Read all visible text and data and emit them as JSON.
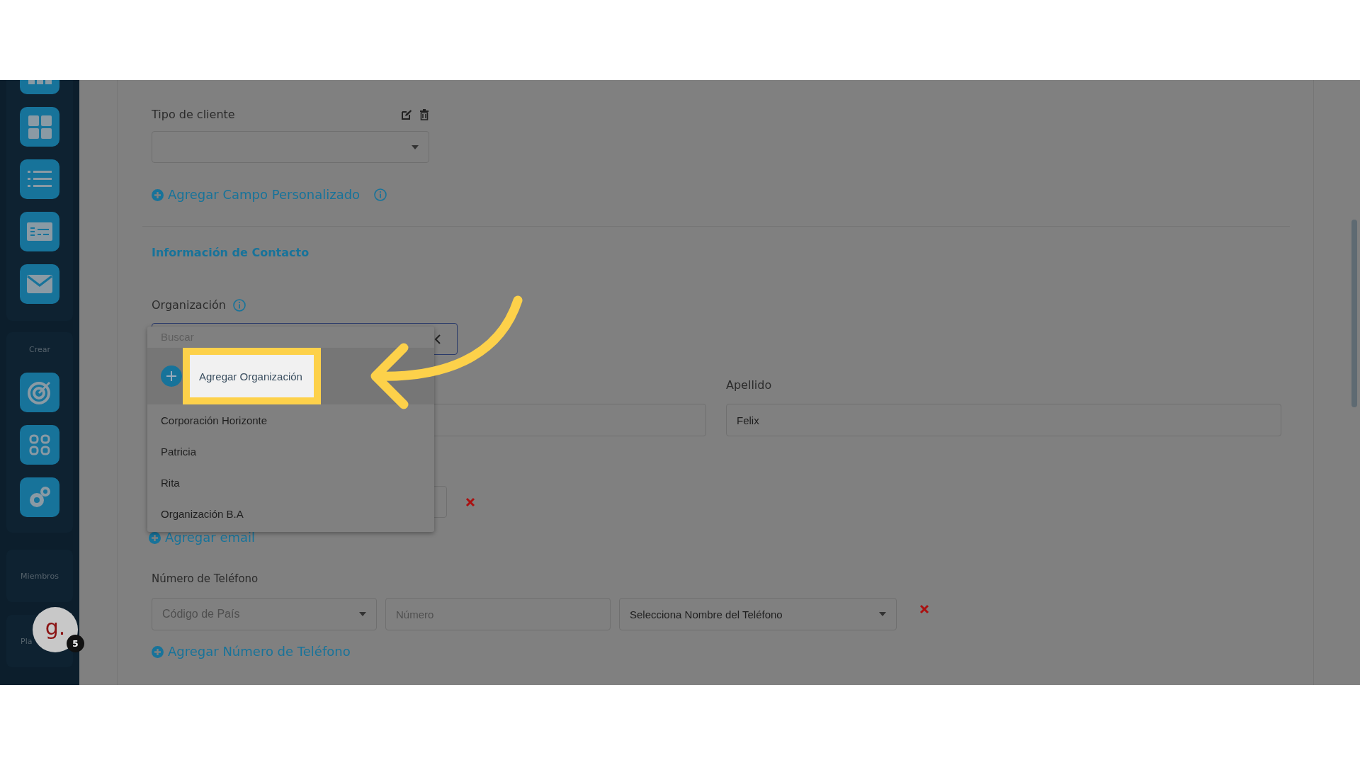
{
  "sidebar": {
    "create_label": "Crear",
    "members_label": "Miembros",
    "plan_label": "Pla",
    "avatar": {
      "initial": "g.",
      "badge": "5"
    }
  },
  "client_type": {
    "label": "Tipo de cliente"
  },
  "add_custom_field": "Agregar Campo Personalizado",
  "contact_section": {
    "title": "Información de Contacto"
  },
  "organization": {
    "label": "Organización",
    "search_placeholder": "Buscar",
    "options": [
      {
        "kind": "add",
        "label": "Agregar Organización",
        "selected": true
      },
      {
        "kind": "option",
        "label": "Corporación Horizonte",
        "selected": false
      },
      {
        "kind": "option",
        "label": "Patricia",
        "selected": false
      },
      {
        "kind": "option",
        "label": "Rita",
        "selected": false
      },
      {
        "kind": "option",
        "label": "Organización B.A",
        "selected": false
      }
    ]
  },
  "last_name": {
    "label": "Apellido",
    "value": "Felix"
  },
  "add_email": "Agregar email",
  "phone": {
    "label": "Número de Teléfono",
    "country_placeholder": "Código de País",
    "number_placeholder": "Número",
    "name_placeholder": "Selecciona Nombre del Teléfono"
  },
  "add_phone": "Agregar Número de Teléfono"
}
